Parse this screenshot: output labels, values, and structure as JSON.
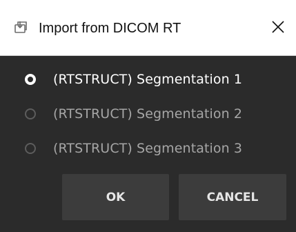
{
  "window": {
    "title": "Import from DICOM RT",
    "icon": "import-rt-icon",
    "close_icon": "close-icon"
  },
  "options": [
    {
      "label": "(RTSTRUCT) Segmentation 1",
      "selected": true
    },
    {
      "label": "(RTSTRUCT) Segmentation 2",
      "selected": false
    },
    {
      "label": "(RTSTRUCT) Segmentation 3",
      "selected": false
    }
  ],
  "buttons": {
    "ok_label": "OK",
    "cancel_label": "CANCEL"
  },
  "colors": {
    "titlebar_bg": "#ffffff",
    "dialog_bg": "#2b2b2b",
    "button_bg": "#3c3c3c",
    "selected_text": "#ffffff",
    "unselected_text": "#a6a6a6"
  }
}
